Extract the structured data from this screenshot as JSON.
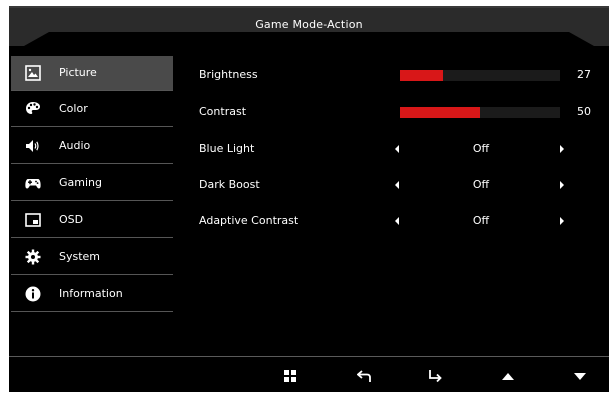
{
  "header": {
    "title": "Game Mode-Action"
  },
  "sidebar": {
    "items": [
      {
        "label": "Picture",
        "icon": "picture-icon",
        "active": true
      },
      {
        "label": "Color",
        "icon": "palette-icon",
        "active": false
      },
      {
        "label": "Audio",
        "icon": "speaker-icon",
        "active": false
      },
      {
        "label": "Gaming",
        "icon": "gamepad-icon",
        "active": false
      },
      {
        "label": "OSD",
        "icon": "osd-icon",
        "active": false
      },
      {
        "label": "System",
        "icon": "gear-icon",
        "active": false
      },
      {
        "label": "Information",
        "icon": "info-icon",
        "active": false
      }
    ]
  },
  "settings": {
    "brightness": {
      "label": "Brightness",
      "value": "27",
      "level": 0.27
    },
    "contrast": {
      "label": "Contrast",
      "value": "50",
      "level": 0.5
    },
    "blue_light": {
      "label": "Blue Light",
      "value": "Off"
    },
    "dark_boost": {
      "label": "Dark Boost",
      "value": "Off"
    },
    "adaptive_contrast": {
      "label": "Adaptive Contrast",
      "value": "Off"
    }
  },
  "bottom_bar": {
    "icons": [
      "menu-grid-icon",
      "back-icon",
      "enter-icon",
      "up-icon",
      "down-icon"
    ]
  },
  "colors": {
    "accent": "#d81718",
    "background": "#000000",
    "active_row": "#4a4a4a",
    "track": "#1b1b1b"
  }
}
